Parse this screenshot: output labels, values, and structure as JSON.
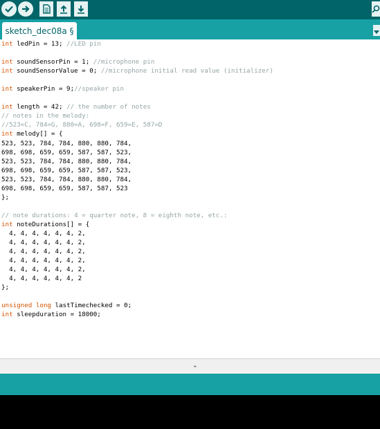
{
  "toolbar": {
    "buttons": [
      "verify-icon",
      "upload-icon",
      "new-icon",
      "open-icon",
      "save-icon"
    ],
    "right_button": "serial-monitor-icon"
  },
  "tab": {
    "label": "sketch_dec08a §"
  },
  "colors": {
    "toolbar": "#006468",
    "tabbar": "#17a1a5",
    "keyword": "#d35400",
    "comment": "#95a5a6"
  },
  "code_lines": [
    [
      [
        "kw",
        "int"
      ],
      [
        "t",
        " ledPin = 13; "
      ],
      [
        "cm",
        "//LED pin"
      ]
    ],
    [],
    [
      [
        "kw",
        "int"
      ],
      [
        "t",
        " soundSensorPin = 1; "
      ],
      [
        "cm",
        "//microphone pin"
      ]
    ],
    [
      [
        "kw",
        "int"
      ],
      [
        "t",
        " soundSensorValue = 0; "
      ],
      [
        "cm",
        "//microphone initial read value (initializer)"
      ]
    ],
    [],
    [
      [
        "kw",
        "int"
      ],
      [
        "t",
        " speakerPin = 9;"
      ],
      [
        "cm",
        "//speaker pin"
      ]
    ],
    [],
    [
      [
        "kw",
        "int"
      ],
      [
        "t",
        " length = 42; "
      ],
      [
        "cm",
        "// the number of notes"
      ]
    ],
    [
      [
        "cm",
        "// notes in the melody:"
      ]
    ],
    [
      [
        "cm",
        "//523=C, 784=G, 880=A, 698=F, 659=E, 587=D"
      ]
    ],
    [
      [
        "kw",
        "int"
      ],
      [
        "t",
        " melody[] = {"
      ]
    ],
    [
      [
        "t",
        "523, 523, 784, 784, 880, 880, 784,"
      ]
    ],
    [
      [
        "t",
        "698, 698, 659, 659, 587, 587, 523,"
      ]
    ],
    [
      [
        "t",
        "523, 523, 784, 784, 880, 880, 784,"
      ]
    ],
    [
      [
        "t",
        "698, 698, 659, 659, 587, 587, 523,"
      ]
    ],
    [
      [
        "t",
        "523, 523, 784, 784, 880, 880, 784,"
      ]
    ],
    [
      [
        "t",
        "698, 698, 659, 659, 587, 587, 523"
      ]
    ],
    [
      [
        "t",
        "};"
      ]
    ],
    [],
    [
      [
        "cm",
        "// note durations: 4 = quarter note, 8 = eighth note, etc.:"
      ]
    ],
    [
      [
        "kw",
        "int"
      ],
      [
        "t",
        " noteDurations[] = {"
      ]
    ],
    [
      [
        "t",
        "  4, 4, 4, 4, 4, 4, 2,"
      ]
    ],
    [
      [
        "t",
        "  4, 4, 4, 4, 4, 4, 2,"
      ]
    ],
    [
      [
        "t",
        "  4, 4, 4, 4, 4, 4, 2,"
      ]
    ],
    [
      [
        "t",
        "  4, 4, 4, 4, 4, 4, 2,"
      ]
    ],
    [
      [
        "t",
        "  4, 4, 4, 4, 4, 4, 2,"
      ]
    ],
    [
      [
        "t",
        "  4, 4, 4, 4, 4, 4, 2"
      ]
    ],
    [
      [
        "t",
        "};"
      ]
    ],
    [],
    [
      [
        "kw",
        "unsigned"
      ],
      [
        "t",
        " "
      ],
      [
        "kw",
        "long"
      ],
      [
        "t",
        " lastTimechecked = 0;"
      ]
    ],
    [
      [
        "kw",
        "int"
      ],
      [
        "t",
        " sleepduration = 18000;"
      ]
    ]
  ],
  "splitter": {
    "arrow": "⌃"
  }
}
